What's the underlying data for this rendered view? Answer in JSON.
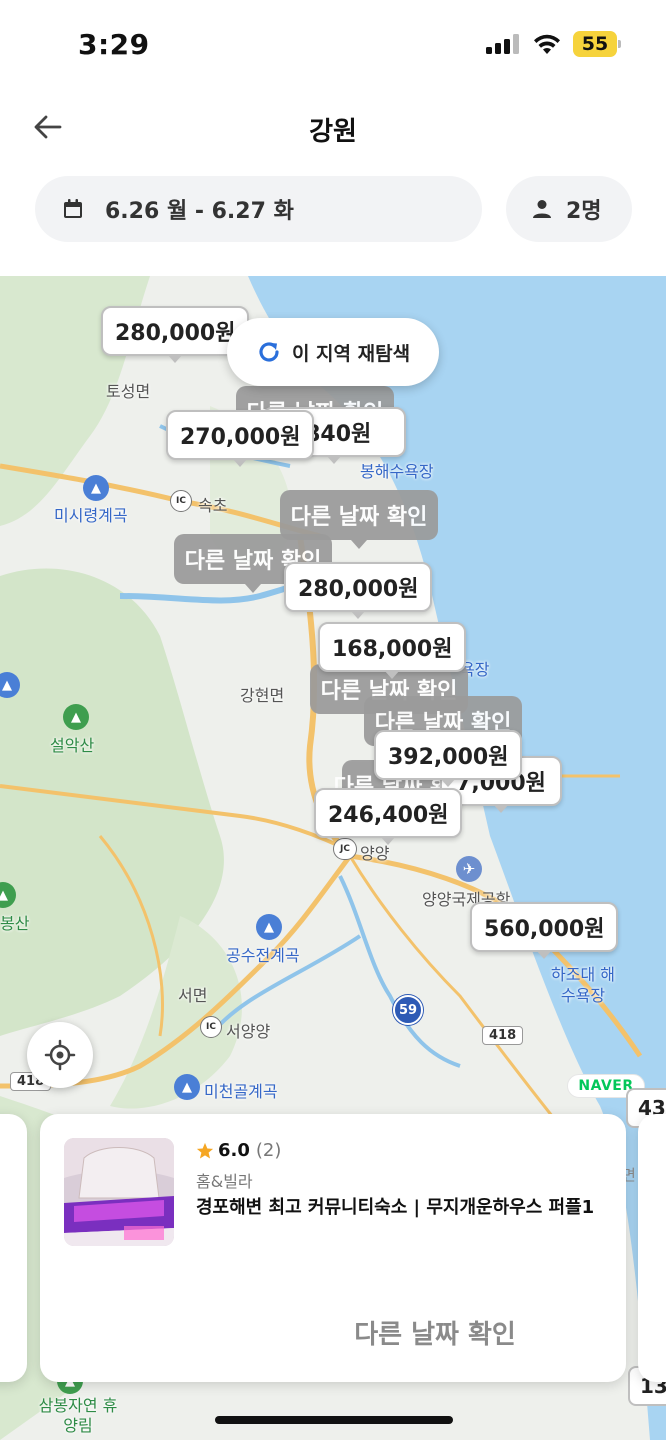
{
  "status_bar": {
    "time": "3:29",
    "battery": "55"
  },
  "header": {
    "title": "강원",
    "back_icon": "arrow-left-icon"
  },
  "filters": {
    "dates": "6.26 월 - 6.27 화",
    "guests": "2명"
  },
  "map": {
    "research_label": "이 지역 재탐색",
    "attribution": "NAVER",
    "markers_price": [
      "280,000원",
      "270,000원",
      ",840원",
      "280,000원",
      "168,000원",
      "392,000원",
      "7,000원",
      "246,400원",
      "560,000원"
    ],
    "markers_other": [
      "다른 날짜 확인",
      "다른 날짜 확인",
      "다른 날짜 확인",
      "다른 날짜 확인",
      "다른 날짜 확인",
      "다른 날짜 확인",
      "다른 날짜 확인"
    ],
    "places": [
      "토성면",
      "미시령계곡",
      "속초",
      "설악산",
      "강현면",
      "봉산",
      "양양",
      "양양국제공항",
      "공수전계곡",
      "서면",
      "서양양",
      "미천골계곡",
      "하조대 해수욕장",
      "삼봉자연 휴양림",
      "봉해수욕장",
      "욕장",
      "양"
    ],
    "road_numbers": [
      "59",
      "418",
      "418"
    ],
    "edge_prices": [
      "43",
      "13"
    ]
  },
  "card": {
    "rating": "6.0",
    "review_count": "(2)",
    "category": "홈&빌라",
    "name": "경포해변 최고 커뮤니티숙소 | 무지개운하우스 퍼플1",
    "action": "다른 날짜 확인",
    "edge_text": "면"
  },
  "colors": {
    "sea": "#a8d4f2",
    "land": "#eef0ec",
    "forest": "#d5e6cc",
    "road": "#f3c26b",
    "accent_blue": "#2a6fdb"
  }
}
